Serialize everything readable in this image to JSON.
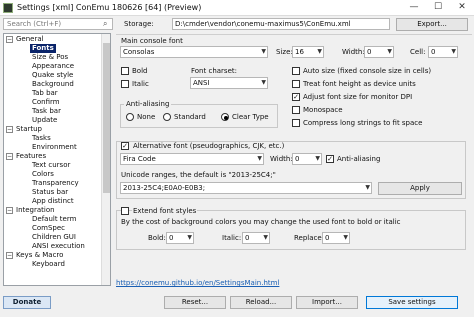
{
  "window": {
    "title": "Settings [xml] ConEmu 180626 [64] (Preview)",
    "minimize": "—",
    "maximize": "☐",
    "close": "✕"
  },
  "search": {
    "placeholder": "Search (Ctrl+F)",
    "icon": "search-icon"
  },
  "tree": {
    "items": [
      {
        "label": "General",
        "toggle": "−"
      },
      {
        "label": "Fonts",
        "selected": true
      },
      {
        "label": "Size & Pos"
      },
      {
        "label": "Appearance"
      },
      {
        "label": "Quake style"
      },
      {
        "label": "Background"
      },
      {
        "label": "Tab bar"
      },
      {
        "label": "Confirm"
      },
      {
        "label": "Task bar"
      },
      {
        "label": "Update"
      },
      {
        "label": "Startup",
        "toggle": "−"
      },
      {
        "label": "Tasks"
      },
      {
        "label": "Environment"
      },
      {
        "label": "Features",
        "toggle": "−"
      },
      {
        "label": "Text cursor"
      },
      {
        "label": "Colors"
      },
      {
        "label": "Transparency"
      },
      {
        "label": "Status bar"
      },
      {
        "label": "App distinct"
      },
      {
        "label": "Integration",
        "toggle": "−"
      },
      {
        "label": "Default term"
      },
      {
        "label": "ComSpec"
      },
      {
        "label": "Children GUI"
      },
      {
        "label": "ANSI execution"
      },
      {
        "label": "Keys & Macro",
        "toggle": "−"
      },
      {
        "label": "Keyboard"
      }
    ]
  },
  "storage": {
    "label": "Storage:",
    "value": "D:\\cmder\\vendor\\conemu-maximus5\\ConEmu.xml",
    "export": "Export..."
  },
  "main_font": {
    "label": "Main console font",
    "value": "Consolas",
    "size_label": "Size:",
    "size": "16",
    "width_label": "Width:",
    "width": "0",
    "cell_label": "Cell:",
    "cell": "0",
    "bold": "Bold",
    "italic": "Italic",
    "charset_label": "Font charset:",
    "charset": "ANSI"
  },
  "options": [
    {
      "label": "Auto size (fixed console size in cells)",
      "checked": false
    },
    {
      "label": "Treat font height as device units",
      "checked": false
    },
    {
      "label": "Adjust font size for monitor DPI",
      "checked": true
    },
    {
      "label": "Monospace",
      "checked": false
    },
    {
      "label": "Compress long strings to fit space",
      "checked": false
    }
  ],
  "antialias": {
    "label": "Anti-aliasing",
    "options": [
      "None",
      "Standard",
      "Clear Type"
    ],
    "selected": "Clear Type"
  },
  "alt_font": {
    "label": "Alternative font (pseudographics, CJK, etc.)",
    "checked": true,
    "value": "Fira Code",
    "width_label": "Width:",
    "width": "0",
    "antialias": "Anti-aliasing",
    "antialias_checked": true,
    "ranges_label": "Unicode ranges, the default is \"2013-25C4;\"",
    "ranges_value": "2013-25C4;E0A0-E0B3;",
    "apply": "Apply"
  },
  "extend": {
    "label": "Extend font styles",
    "checked": false,
    "desc": "By the cost of background colors you may change the used font to bold or italic",
    "bold_label": "Bold:",
    "bold": "0",
    "italic_label": "Italic:",
    "italic": "0",
    "replace_label": "Replace:",
    "replace": "0"
  },
  "link": "https://conemu.github.io/en/SettingsMain.html",
  "footer": {
    "donate": "Donate",
    "reset": "Reset...",
    "reload": "Reload...",
    "import": "Import...",
    "save": "Save settings"
  }
}
